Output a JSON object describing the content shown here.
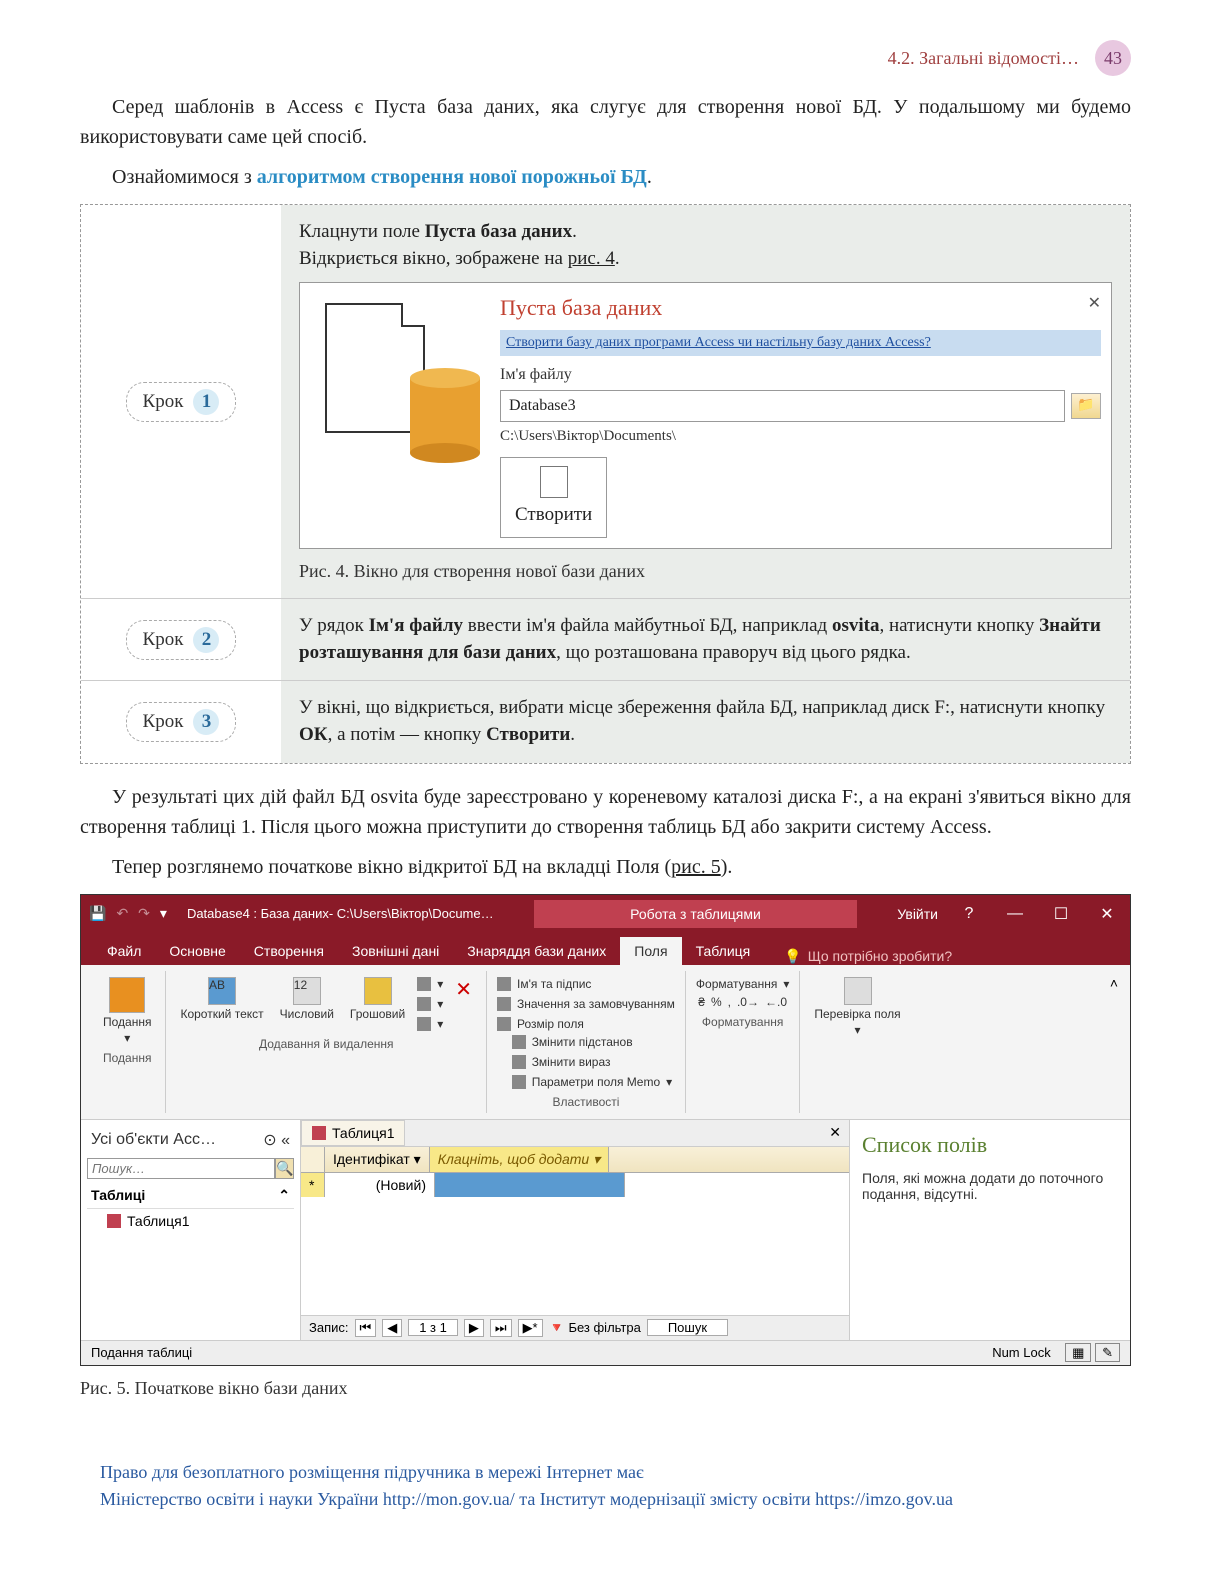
{
  "header": {
    "section": "4.2. Загальні відомості…",
    "page": "43"
  },
  "para1_a": "Серед шаблонів в Access є Пуста база даних, яка слугує для створення нової БД. У подальшому ми будемо використовувати саме цей спосіб.",
  "para2_a": "Ознайомимося з ",
  "para2_b": "алгоритмом створення нової порожньої БД",
  "para2_c": ".",
  "steps": {
    "label": "Крок",
    "s1": {
      "num": "1",
      "line1a": "Клацнути поле ",
      "line1b": "Пуста база даних",
      "line1c": ".",
      "line2a": "Відкриється вікно, зображене на ",
      "line2b": "рис. 4",
      "line2c": "."
    },
    "s2": {
      "num": "2",
      "t1": "У рядок ",
      "t2": "Ім'я файлу",
      "t3": " ввести ім'я файла майбутньої БД, наприклад ",
      "t4": "osvita",
      "t5": ", натиснути кнопку ",
      "t6": "Знайти розташування для бази даних",
      "t7": ", що розташована праворуч від цього рядка."
    },
    "s3": {
      "num": "3",
      "t1": "У вікні, що відкриється, вибрати місце збереження файла БД, наприклад диск F:, натиснути кнопку ",
      "t2": "ОК",
      "t3": ", а потім — кнопку ",
      "t4": "Створити",
      "t5": "."
    }
  },
  "fig4": {
    "title": "Пуста база даних",
    "link": "Створити базу даних програми Access чи настільну базу даних Access?",
    "filename_label": "Ім'я файлу",
    "filename_value": "Database3",
    "path": "C:\\Users\\Віктор\\Documents\\",
    "create": "Створити",
    "close": "✕",
    "caption": "Рис. 4. Вікно для створення нової бази даних"
  },
  "para3": "У результаті цих дій файл БД osvita буде зареєстровано у кореневому каталозі диска F:, а на екрані з'явиться вікно для створення таблиці 1. Після цього можна приступити до створення таблиць БД або закрити систему Access.",
  "para4_a": "Тепер розглянемо початкове вікно відкритої БД на вкладці Поля (",
  "para4_b": "рис. 5",
  "para4_c": ").",
  "access": {
    "title": "Database4 : База даних- C:\\Users\\Віктор\\Docume…",
    "context": "Робота з таблицями",
    "signin": "Увійти",
    "tabs": {
      "file": "Файл",
      "home": "Основне",
      "create": "Створення",
      "ext": "Зовнішні дані",
      "tools": "Знаряддя бази даних",
      "fields": "Поля",
      "table": "Таблиця"
    },
    "tellme": "Що потрібно зробити?",
    "ribbon": {
      "views": "Подання",
      "views_group": "Подання",
      "short_text": "Короткий текст",
      "number": "Числовий",
      "currency": "Грошовий",
      "twelve": "12",
      "add_del_group": "Додавання й видалення",
      "name_caption": "Ім'я та підпис",
      "default_val": "Значення за замовчуванням",
      "field_size": "Розмір поля",
      "props_group": "Властивості",
      "modify_lookup": "Змінити підстанов",
      "modify_expr": "Змінити вираз",
      "memo_params": "Параметри поля Memo",
      "formatting": "Форматування",
      "formatting_group": "Форматування",
      "validation": "Перевірка поля"
    },
    "nav": {
      "header": "Усі об'єкти Acc…",
      "search_ph": "Пошук…",
      "group": "Таблиці",
      "item": "Таблиця1"
    },
    "datasheet": {
      "tab": "Таблиця1",
      "col1": "Ідентифікат",
      "col2": "Клацніть, щоб додати",
      "new_row": "(Новий)",
      "record_label": "Запис:",
      "record_pos": "1 з 1",
      "no_filter": "Без фільтра",
      "search": "Пошук"
    },
    "sidepanel": {
      "title": "Список полів",
      "text": "Поля, які можна додати до поточного подання, відсутні."
    },
    "status": {
      "left": "Подання таблиці",
      "numlock": "Num Lock"
    }
  },
  "fig5_caption": "Рис. 5. Початкове вікно бази даних",
  "footer": {
    "line1": "Право для безоплатного розміщення підручника в мережі Інтернет має",
    "line2a": "Міністерство освіти і науки України ",
    "url1": "http://mon.gov.ua/",
    "line2b": " та Інститут модернізації змісту освіти ",
    "url2": "https://imzo.gov.ua"
  }
}
